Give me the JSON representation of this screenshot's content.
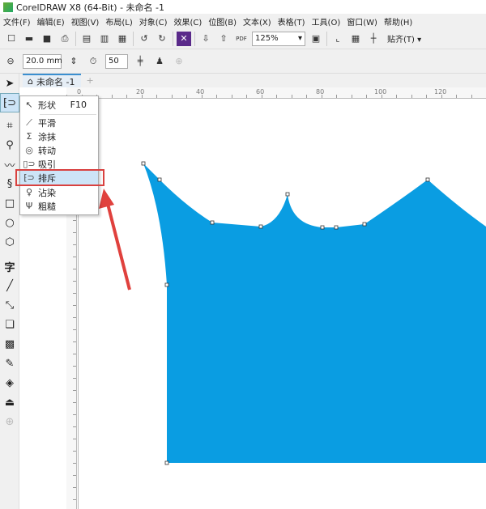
{
  "window": {
    "title": "CorelDRAW X8 (64-Bit) - 未命名 -1"
  },
  "menu": [
    "文件(F)",
    "编辑(E)",
    "视图(V)",
    "布局(L)",
    "对象(C)",
    "效果(C)",
    "位图(B)",
    "文本(X)",
    "表格(T)",
    "工具(O)",
    "窗口(W)",
    "帮助(H)"
  ],
  "toolbar": {
    "zoom": "125%",
    "snap": "贴齐(T)",
    "pdf": "PDF"
  },
  "property_bar": {
    "nib_size": "20.0 mm",
    "speed": "50"
  },
  "document_tab": "未命名 -1",
  "ruler_h": [
    "0",
    "20",
    "40",
    "60",
    "80",
    "100",
    "120"
  ],
  "flyout": {
    "items": [
      {
        "icon": "shape-tool-icon",
        "label": "形状",
        "shortcut": "F10"
      },
      {
        "icon": "smooth-icon",
        "label": "平滑"
      },
      {
        "icon": "smear-icon",
        "label": "涂抹"
      },
      {
        "icon": "twirl-icon",
        "label": "转动"
      },
      {
        "icon": "attract-icon",
        "label": "吸引"
      },
      {
        "icon": "repel-icon",
        "label": "排斥",
        "selected": true
      },
      {
        "icon": "smudge-icon",
        "label": "沾染"
      },
      {
        "icon": "roughen-icon",
        "label": "粗糙"
      }
    ]
  },
  "colors": {
    "shape_fill": "#0a9de2",
    "highlight": "#d9413f",
    "arrow": "#e0413d"
  }
}
